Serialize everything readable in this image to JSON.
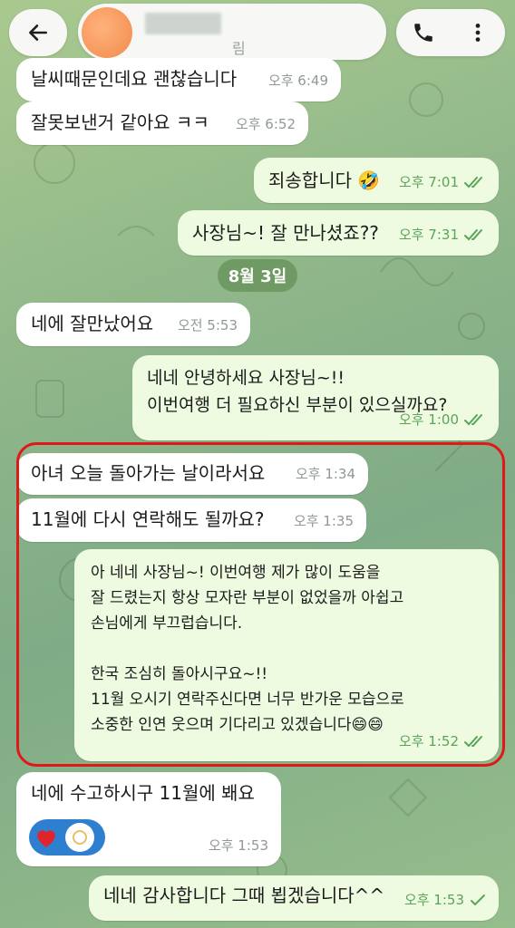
{
  "header": {
    "status_text": "림"
  },
  "date_divider": "8월 3일",
  "messages": [
    {
      "text": "날씨때문인데요 괜찮습니다",
      "time": "오후 6:49"
    },
    {
      "text": "잘못보낸거 같아요 ㅋㅋ",
      "time": "오후 6:52"
    },
    {
      "text": "죄송합니다 🤣",
      "time": "오후 7:01"
    },
    {
      "text": "사장님~! 잘 만나셨죠??",
      "time": "오후 7:31"
    },
    {
      "text": "네에 잘만났어요",
      "time": "오전 5:53"
    },
    {
      "text": "네네 안녕하세요 사장님~!!\n이번여행 더 필요하신 부분이 있으실까요?",
      "time": "오후 1:00"
    },
    {
      "text": "아녀 오늘 돌아가는 날이라서요",
      "time": "오후 1:34"
    },
    {
      "text": "11월에 다시 연락해도 될까요?",
      "time": "오후 1:35"
    },
    {
      "text": "아 네네 사장님~! 이번여행 제가 많이 도움을\n잘 드렸는지 항상 모자란 부분이 없었을까 아쉽고\n손님에게 부끄럽습니다.\n\n한국 조심히 돌아시구요~!!\n11월 오시기 연락주신다면 너무 반가운 모습으로\n소중한 인연 웃으며 기다리고 있겠습니다😄😄",
      "time": "오후 1:52"
    },
    {
      "text": "네에 수고하시구 11월에 봬요",
      "time": "오후 1:53"
    },
    {
      "text": "네네 감사합니다 그때 뵙겠습니다^^",
      "time": "오후 1:53"
    }
  ],
  "colors": {
    "incoming_bubble": "#ffffff",
    "outgoing_bubble": "#eefbe0",
    "read_check": "#5aa45a",
    "highlight_border": "#e01818",
    "date_chip": "#6f9a63",
    "reaction_pill": "#2f7fd1"
  },
  "icons": {
    "back": "arrow-left-icon",
    "call": "phone-icon",
    "menu": "more-vert-icon",
    "read": "double-check-icon",
    "sent": "single-check-icon",
    "reaction": "heart-icon"
  }
}
